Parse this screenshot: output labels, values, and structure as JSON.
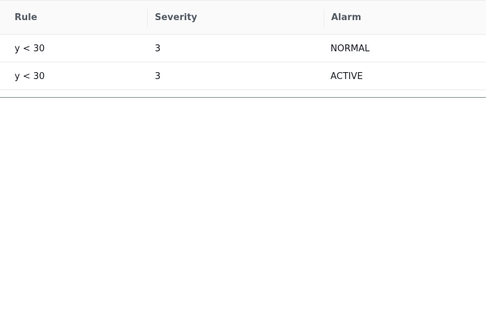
{
  "table": {
    "columns": [
      "Rule",
      "Severity",
      "Alarm"
    ],
    "rows": [
      {
        "rule": "y < 30",
        "severity": "3",
        "alarm": "NORMAL"
      },
      {
        "rule": "y < 30",
        "severity": "3",
        "alarm": "ACTIVE"
      }
    ]
  },
  "colors": {
    "header_bg": "#fafafa",
    "header_text": "#545b64",
    "cell_text": "#16191f",
    "row_border": "#eaeded",
    "table_bottom_border": "#879596"
  }
}
